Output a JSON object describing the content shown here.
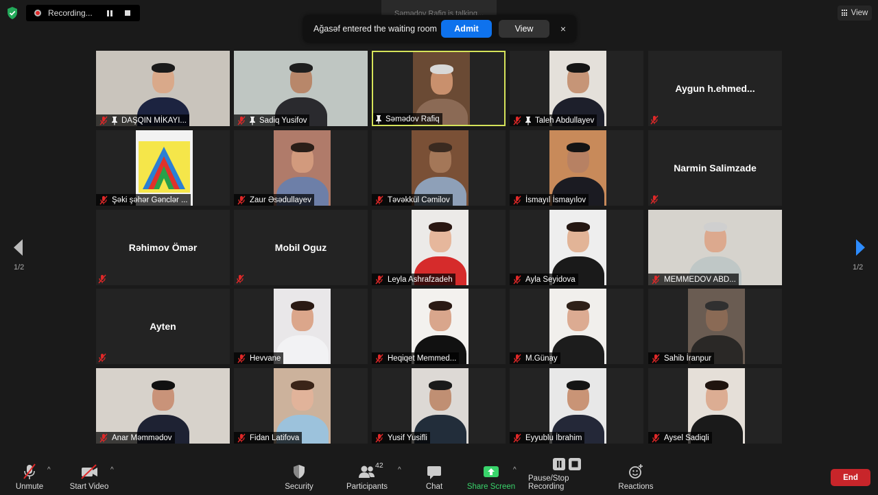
{
  "recording": {
    "label": "Recording..."
  },
  "talking": "Səmədov Rafiq is talking...",
  "notification": {
    "text": "Ağasəf entered the waiting room",
    "admit": "Admit",
    "view": "View",
    "close": "×"
  },
  "view_button": "View",
  "tiles": [
    {
      "name": "DAŞQIN MİKAYI...",
      "pinned": true
    },
    {
      "name": "Sadiq Yusifov",
      "pinned": true
    },
    {
      "name": "Səmədov Rafiq",
      "pinned": true,
      "mic_muted": false,
      "active": true
    },
    {
      "name": "Taleh Abdullayev",
      "pinned": true
    },
    {
      "name": "Aygun  h.ehmed...",
      "video": false
    },
    {
      "name": "Şəki şəhər Gənclər ..."
    },
    {
      "name": "Zaur Əsədullayev"
    },
    {
      "name": "Təvəkkül Cəmilov"
    },
    {
      "name": "İsmayıl İsmayılov"
    },
    {
      "name": "Narmin Salimzade",
      "video": false
    },
    {
      "name": "Rəhimov Ömər",
      "video": false
    },
    {
      "name": "Mobil Oguz",
      "video": false
    },
    {
      "name": "Leyla Ashrafzadeh"
    },
    {
      "name": "Ayla Seyidova"
    },
    {
      "name": "MEMMEDOV ABD..."
    },
    {
      "name": "Ayten",
      "video": false
    },
    {
      "name": "Hevvane"
    },
    {
      "name": "Heqiqet Memmed..."
    },
    {
      "name": "M.Günay"
    },
    {
      "name": "Sahib İranpur"
    },
    {
      "name": "Anar Məmmədov"
    },
    {
      "name": "Fidan Latifova"
    },
    {
      "name": "Yusif Yusifli"
    },
    {
      "name": "Eyyublu İbrahim"
    },
    {
      "name": "Aysel Sadiqli"
    }
  ],
  "pagination": {
    "left": "1/2",
    "right": "1/2"
  },
  "toolbar": {
    "unmute": "Unmute",
    "start_video": "Start Video",
    "security": "Security",
    "participants": "Participants",
    "participants_count": "42",
    "chat": "Chat",
    "share_screen": "Share Screen",
    "pause_stop_recording": "Pause/Stop Recording",
    "reactions": "Reactions",
    "end": "End"
  },
  "colors": {
    "accent": "#0e72ed",
    "end": "#c8252a",
    "share": "#39d46b",
    "active_border": "#d6e45a",
    "mute": "#e02828"
  }
}
